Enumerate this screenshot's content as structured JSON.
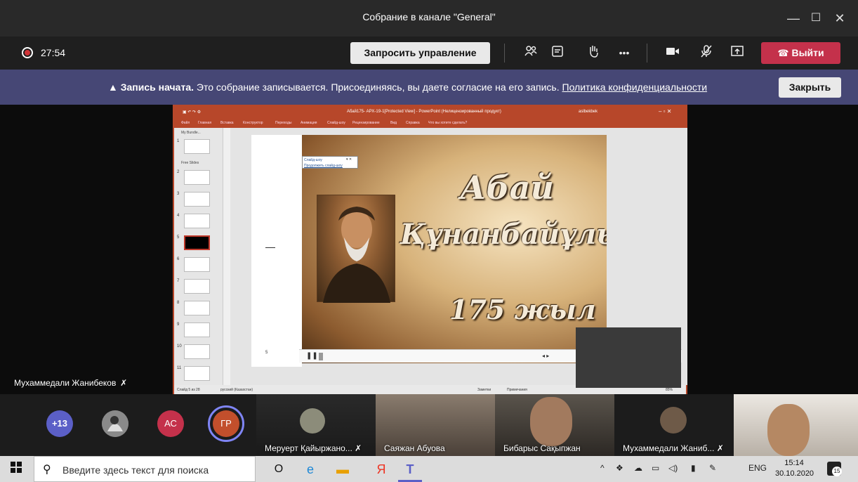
{
  "window": {
    "title": "Собрание в канале \"General\"",
    "controls": {
      "minimize": "—",
      "maximize": "☐",
      "close": "✕"
    }
  },
  "meeting": {
    "timer": "27:54",
    "request_control_label": "Запросить управление",
    "leave_label": "Выйти",
    "icons": [
      "participants-icon",
      "chat-icon",
      "raise-hand-icon",
      "more-icon",
      "camera-icon",
      "mic-off-icon",
      "share-icon"
    ]
  },
  "banner": {
    "title": "Запись начата.",
    "message": "Это собрание записывается. Присоединяясь, вы даете согласие на его запись.",
    "link": "Политика конфиденциальности",
    "close_label": "Закрыть"
  },
  "presenter": {
    "name": "Мухаммедали Жанибеков"
  },
  "powerpoint": {
    "title": "Абай175- АРХ-19-1[Protected View] - PowerPoint (Нелицензированный продукт)",
    "user": "aslbekbek",
    "menu": [
      "Файл",
      "Главная",
      "Вставка",
      "Конструктор",
      "Переходы",
      "Анимация",
      "Слайд-шоу",
      "Рецензирование",
      "Вид",
      "Справка",
      "Что вы хотите сделать?"
    ],
    "sections": [
      "My Bundle...",
      "Free Slides"
    ],
    "slide_numbers": [
      "1",
      "2",
      "3",
      "4",
      "5",
      "6",
      "7",
      "8",
      "9",
      "10",
      "11"
    ],
    "popup": {
      "title": "Слайд-шоу",
      "link": "Продолжить слайд-шоу"
    },
    "slide": {
      "line1": "Абай",
      "line2": "Құнанбайұлы",
      "line3": "175 жыл"
    },
    "notes_page": "5",
    "status": {
      "slide": "Слайд 5 из 28",
      "language": "русский (Казахстан)",
      "notes": "Заметки",
      "comments": "Примечания",
      "zoom": "85%"
    }
  },
  "participants": {
    "overflow": "+13",
    "avatars": [
      {
        "initials": "",
        "color": "#6b6b6b"
      },
      {
        "initials": "АС",
        "color": "#c4314b"
      },
      {
        "initials": "ГР",
        "color": "#c24f2c"
      }
    ],
    "tiles": [
      {
        "name": "Меруерт Қайыржано...",
        "muted": true
      },
      {
        "name": "Саяжан Абуова",
        "muted": false
      },
      {
        "name": "Бибарыс Сақыпжан",
        "muted": false
      },
      {
        "name": "Мухаммедали Жаниб...",
        "muted": true
      },
      {
        "name": "",
        "muted": false
      }
    ]
  },
  "taskbar": {
    "search_placeholder": "Введите здесь текст для поиска",
    "language": "ENG",
    "time": "15:14",
    "date": "30.10.2020",
    "notifications": "15"
  }
}
